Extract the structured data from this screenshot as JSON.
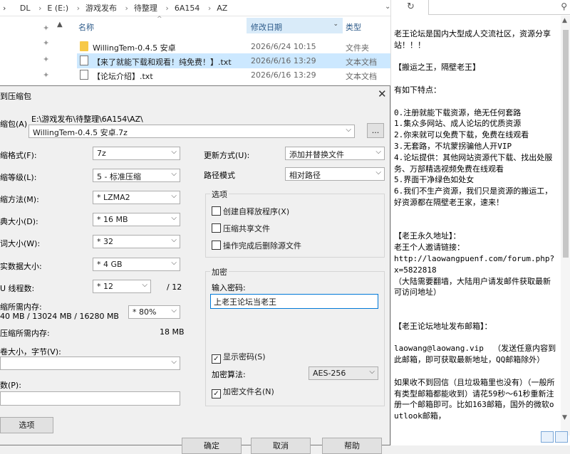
{
  "explorer": {
    "breadcrumbs": [
      "DL",
      "E (E:)",
      "游戏发布",
      "待整理",
      "6A154",
      "AZ"
    ],
    "columns": {
      "name": "名称",
      "date": "修改日期",
      "type": "类型"
    },
    "files": [
      {
        "name": "WillingTem-0.4.5 安卓",
        "date": "2026/6/24 10:15",
        "type": "文件夹"
      },
      {
        "name": "【来了就能下载和观看！纯免费！】.txt",
        "date": "2026/6/16 13:29",
        "type": "文本文档"
      },
      {
        "name": "【论坛介绍】.txt",
        "date": "2026/6/16 13:29",
        "type": "文本文档"
      }
    ]
  },
  "dialog": {
    "title": "到压缩包",
    "archive_label": "缩包(A)",
    "archive_dir": "E:\\游戏发布\\待整理\\6A154\\AZ\\",
    "archive_name": "WillingTem-0.4.5 安卓.7z",
    "browse_label": "...",
    "format_label": "缩格式(F):",
    "format_value": "7z",
    "level_label": "缩等级(L):",
    "level_value": "5 - 标准压缩",
    "method_label": "缩方法(M):",
    "method_value": "* LZMA2",
    "dict_label": "典大小(D):",
    "dict_value": "* 16 MB",
    "word_label": "词大小(W):",
    "word_value": "* 32",
    "solid_label": "实数据大小:",
    "solid_value": "* 4 GB",
    "threads_label": "U 线程数:",
    "threads_value": "* 12",
    "threads_total": "/ 12",
    "mem_label": "缩所需内存:",
    "mem_detail": "40 MB / 13024 MB / 16280 MB",
    "mem_value": "* 80%",
    "decomp_label": "压缩所需内存:",
    "decomp_value": "18 MB",
    "volume_label": "卷大小，字节(V):",
    "params_label": "数(P):",
    "options_button": "选项",
    "update_label": "更新方式(U):",
    "update_value": "添加并替换文件",
    "path_label": "路径模式",
    "path_value": "相对路径",
    "options_group": "选项",
    "opt_sfx": "创建自释放程序(X)",
    "opt_shared": "压缩共享文件",
    "opt_delete": "操作完成后删除源文件",
    "encrypt_group": "加密",
    "pwd_label": "输入密码:",
    "pwd_value": "上老王论坛当老王",
    "show_pwd": "显示密码(S)",
    "enc_method_label": "加密算法:",
    "enc_method_value": "AES-256",
    "enc_names": "加密文件名(N)",
    "ok_button": "确定",
    "cancel_button": "取消",
    "help_button": "帮助"
  },
  "preview": {
    "lines": [
      "老王论坛是国内大型成人交流社区，资源分享站！！！",
      "",
      "【搬运之王，隔壁老王】",
      "",
      "有如下特点：",
      "",
      "0.注册就能下载资源，绝无任何套路",
      "1.集众多网站、成人论坛的优质资源",
      "2.你来就可以免费下载，免费在线观看",
      "3.无套路，不坑蒙拐骗他人开VIP",
      "4.论坛提供：其他网站资源代下载、找出处服务、万部精选视频免费在线观看",
      "5.界面干净绿色如处女",
      "6.我们不生产资源，我们只是资源的搬运工，好资源都在隔壁老王家，速来！",
      "",
      "",
      "【老王永久地址】：",
      "老王个人邀请链接：",
      "http://laowangpuenf.com/forum.php?x=5822818",
      "（大陆需要翻墙，大陆用户请发邮件获取最新可访问地址）",
      "",
      "",
      "【老王论坛地址发布邮箱】：",
      "",
      "laowang@laowang.vip  （发送任意内容到此邮箱，即可获取最新地址，QQ邮箱除外）",
      "",
      "如果收不到回信（且垃圾箱里也没有）（一般所有类型邮箱都能收到）请花59秒～61秒重新注册一个邮箱即可。比如163邮箱，国外的微软outlook邮箱，"
    ]
  },
  "icons": {
    "pin": "pin-icon",
    "folder": "folder-icon",
    "text_file": "text-file-icon"
  }
}
